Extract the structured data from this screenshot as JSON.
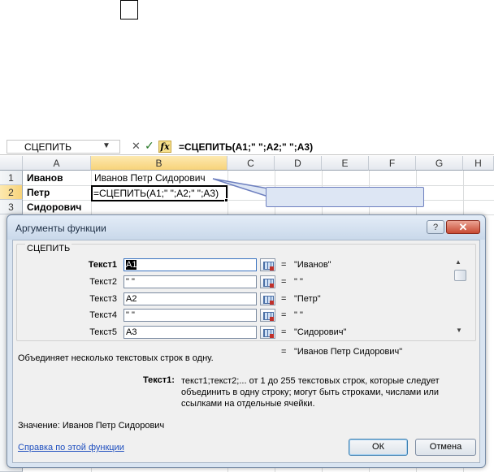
{
  "formula_bar": {
    "name_box": "СЦЕПИТЬ",
    "cancel_glyph": "✕",
    "enter_glyph": "✓",
    "insert_fn_glyph": "fx",
    "formula": "=СЦЕПИТЬ(A1;\" \";A2;\" \";A3)"
  },
  "sheet": {
    "columns": [
      "A",
      "B",
      "C",
      "D",
      "E",
      "F",
      "G",
      "H"
    ],
    "selected_column": "B",
    "rows": [
      "1",
      "2",
      "3"
    ],
    "selected_row": "2",
    "cells": {
      "A1": "Иванов",
      "B1": "Иванов Петр Сидорович",
      "A2": "Петр",
      "B2": "=СЦЕПИТЬ(A1;\" \";A2;\" \";A3)",
      "A3": "Сидорович"
    }
  },
  "dialog": {
    "title": "Аргументы функции",
    "help_glyph": "?",
    "close_glyph": "✕",
    "function_name": "СЦЕПИТЬ",
    "arguments": [
      {
        "label": "Текст1",
        "value": "A1",
        "result": "\"Иванов\""
      },
      {
        "label": "Текст2",
        "value": "\" \"",
        "result": "\" \""
      },
      {
        "label": "Текст3",
        "value": "A2",
        "result": "\"Петр\""
      },
      {
        "label": "Текст4",
        "value": "\" \"",
        "result": "\" \""
      },
      {
        "label": "Текст5",
        "value": "A3",
        "result": "\"Сидорович\""
      }
    ],
    "equals": "=",
    "total_result": "\"Иванов Петр Сидорович\"",
    "function_description": "Объединяет несколько текстовых строк в одну.",
    "arg_desc_label": "Текст1:",
    "arg_description": "текст1;текст2;... от 1 до 255 текстовых строк, которые следует объединить в одну строку; могут быть строками, числами или ссылками на отдельные ячейки.",
    "value_label": "Значение:  Иванов Петр Сидорович",
    "help_link": "Справка по этой функции",
    "ok": "ОК",
    "cancel": "Отмена"
  },
  "colors": {
    "selection_header": "#f7d37a",
    "callout_fill": "#dde6f4",
    "callout_border": "#6d7fbf",
    "close_button": "#c84a33",
    "link": "#1f4fbf"
  }
}
